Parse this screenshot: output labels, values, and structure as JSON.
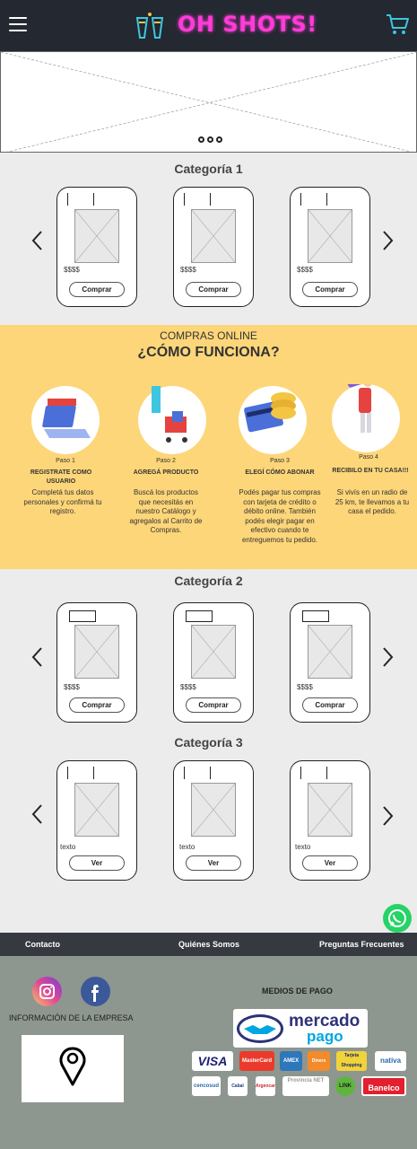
{
  "header": {
    "brand": "OH SHOTS!"
  },
  "colors": {
    "header_bg": "#232831",
    "brand_pink": "#ff3bd8",
    "accent_cyan": "#3ec6e0",
    "how_bg": "#fdd679",
    "footer_nav_bg": "#363a40",
    "footer_bg": "#8e9690",
    "whatsapp": "#25d366"
  },
  "categories": [
    {
      "title": "Categoría 1",
      "cards": [
        {
          "price": "$$$$",
          "button": "Comprar"
        },
        {
          "price": "$$$$",
          "button": "Comprar"
        },
        {
          "price": "$$$$",
          "button": "Comprar"
        }
      ]
    },
    {
      "title": "Categoría 2",
      "cards": [
        {
          "price": "$$$$",
          "button": "Comprar"
        },
        {
          "price": "$$$$",
          "button": "Comprar"
        },
        {
          "price": "$$$$",
          "button": "Comprar"
        }
      ]
    },
    {
      "title": "Categoría 3",
      "cards": [
        {
          "price": "texto",
          "button": "Ver"
        },
        {
          "price": "texto",
          "button": "Ver"
        },
        {
          "price": "texto",
          "button": "Ver"
        }
      ]
    }
  ],
  "how": {
    "kicker": "COMPRAS ONLINE",
    "title": "¿CÓMO FUNCIONA?",
    "steps": [
      {
        "paso": "Paso 1",
        "name": "REGISTRATE COMO USUARIO",
        "desc": "Completá tus datos personales y confirmá tu registro."
      },
      {
        "paso": "Paso 2",
        "name": "AGREGÁ PRODUCTO",
        "desc": "Buscá los productos que necesitás en nuestro Catálogo y agregalos al Carrito de Compras."
      },
      {
        "paso": "Paso 3",
        "name": "ELEGÍ CÓMO ABONAR",
        "desc": "Podés pagar tus compras con tarjeta de crédito o débito online. También podés elegir pagar en efectivo cuando te entreguemos tu pedido."
      },
      {
        "paso": "Paso 4",
        "name": "RECIBILO EN TU CASA!!!",
        "desc": "Si vivís en un radio de 25 km, te llevamos a tu casa el pedido."
      }
    ]
  },
  "footer_nav": {
    "contacto": "Contacto",
    "quienes": "Quiénes Somos",
    "faq": "Preguntas Frecuentes"
  },
  "footer": {
    "company": "INFORMACIÓN DE LA EMPRESA",
    "medios": "MEDIOS DE PAGO",
    "mp_line1": "mercado",
    "mp_line2": "pago",
    "payments_row1": [
      "VISA",
      "MasterCard",
      "AMEX",
      "Diners",
      "Tarjeta Shopping",
      "nativa"
    ],
    "payments_row2": [
      "cencosud",
      "Cabal",
      "Argencard",
      "Provincia NET",
      "LINK",
      "Banelco"
    ]
  }
}
